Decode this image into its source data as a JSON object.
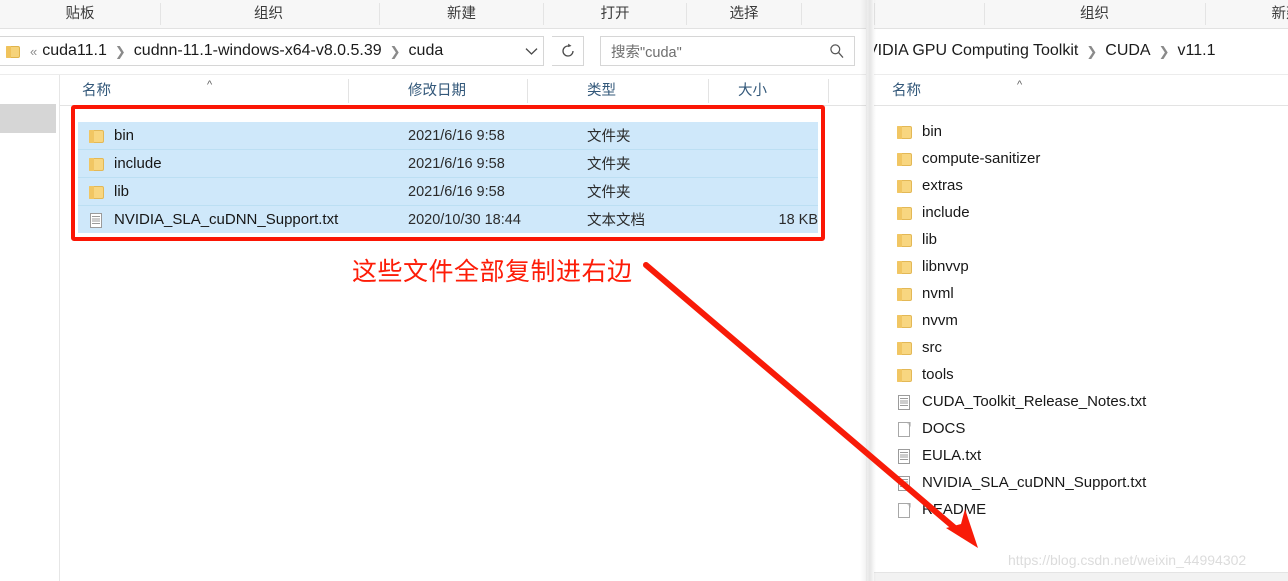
{
  "left_window": {
    "ribbon": {
      "groups": [
        {
          "label": "贴板",
          "name": "ribbon-group-clipboard"
        },
        {
          "label": "组织",
          "name": "ribbon-group-organize"
        },
        {
          "label": "新建",
          "name": "ribbon-group-new"
        },
        {
          "label": "打开",
          "name": "ribbon-group-open"
        },
        {
          "label": "选择",
          "name": "ribbon-group-select"
        }
      ]
    },
    "address": {
      "prefix": "«",
      "crumbs": [
        "cuda11.1",
        "cudnn-11.1-windows-x64-v8.0.5.39",
        "cuda"
      ],
      "dropdown_icon": "chevron-down-icon",
      "refresh_icon": "refresh-icon"
    },
    "search": {
      "placeholder": "搜索\"cuda\"",
      "icon": "search-icon"
    },
    "columns": [
      {
        "label": "名称",
        "sorted": true,
        "sort_caret": "^"
      },
      {
        "label": "修改日期",
        "sorted": false
      },
      {
        "label": "类型",
        "sorted": false
      },
      {
        "label": "大小",
        "sorted": false
      }
    ],
    "files": [
      {
        "name": "bin",
        "date": "2021/6/16 9:58",
        "type": "文件夹",
        "size": "",
        "icon": "folder",
        "selected": true
      },
      {
        "name": "include",
        "date": "2021/6/16 9:58",
        "type": "文件夹",
        "size": "",
        "icon": "folder",
        "selected": true
      },
      {
        "name": "lib",
        "date": "2021/6/16 9:58",
        "type": "文件夹",
        "size": "",
        "icon": "folder",
        "selected": true
      },
      {
        "name": "NVIDIA_SLA_cuDNN_Support.txt",
        "date": "2020/10/30 18:44",
        "type": "文本文档",
        "size": "18 KB",
        "icon": "txt",
        "selected": true
      }
    ]
  },
  "right_window": {
    "ribbon": {
      "groups": [
        {
          "label": "组织",
          "name": "ribbon-group-organize"
        },
        {
          "label": "新建",
          "name": "ribbon-group-new"
        }
      ]
    },
    "address": {
      "crumbs": [
        "VIDIA GPU Computing Toolkit",
        "CUDA",
        "v11.1"
      ]
    },
    "columns": [
      {
        "label": "名称",
        "sorted": true,
        "sort_caret": "^"
      }
    ],
    "files": [
      {
        "name": "bin",
        "icon": "folder"
      },
      {
        "name": "compute-sanitizer",
        "icon": "folder"
      },
      {
        "name": "extras",
        "icon": "folder"
      },
      {
        "name": "include",
        "icon": "folder"
      },
      {
        "name": "lib",
        "icon": "folder"
      },
      {
        "name": "libnvvp",
        "icon": "folder"
      },
      {
        "name": "nvml",
        "icon": "folder"
      },
      {
        "name": "nvvm",
        "icon": "folder"
      },
      {
        "name": "src",
        "icon": "folder"
      },
      {
        "name": "tools",
        "icon": "folder"
      },
      {
        "name": "CUDA_Toolkit_Release_Notes.txt",
        "icon": "txt"
      },
      {
        "name": "DOCS",
        "icon": "blank"
      },
      {
        "name": "EULA.txt",
        "icon": "txt"
      },
      {
        "name": "NVIDIA_SLA_cuDNN_Support.txt",
        "icon": "txt"
      },
      {
        "name": "README",
        "icon": "blank"
      }
    ]
  },
  "annotations": {
    "callout_text": "这些文件全部复制进右边",
    "callout_color": "#fd1c07",
    "highlight_box_color": "#fb1605",
    "arrow_color": "#f81b08",
    "watermark": "https://blog.csdn.net/weixin_44994302"
  }
}
